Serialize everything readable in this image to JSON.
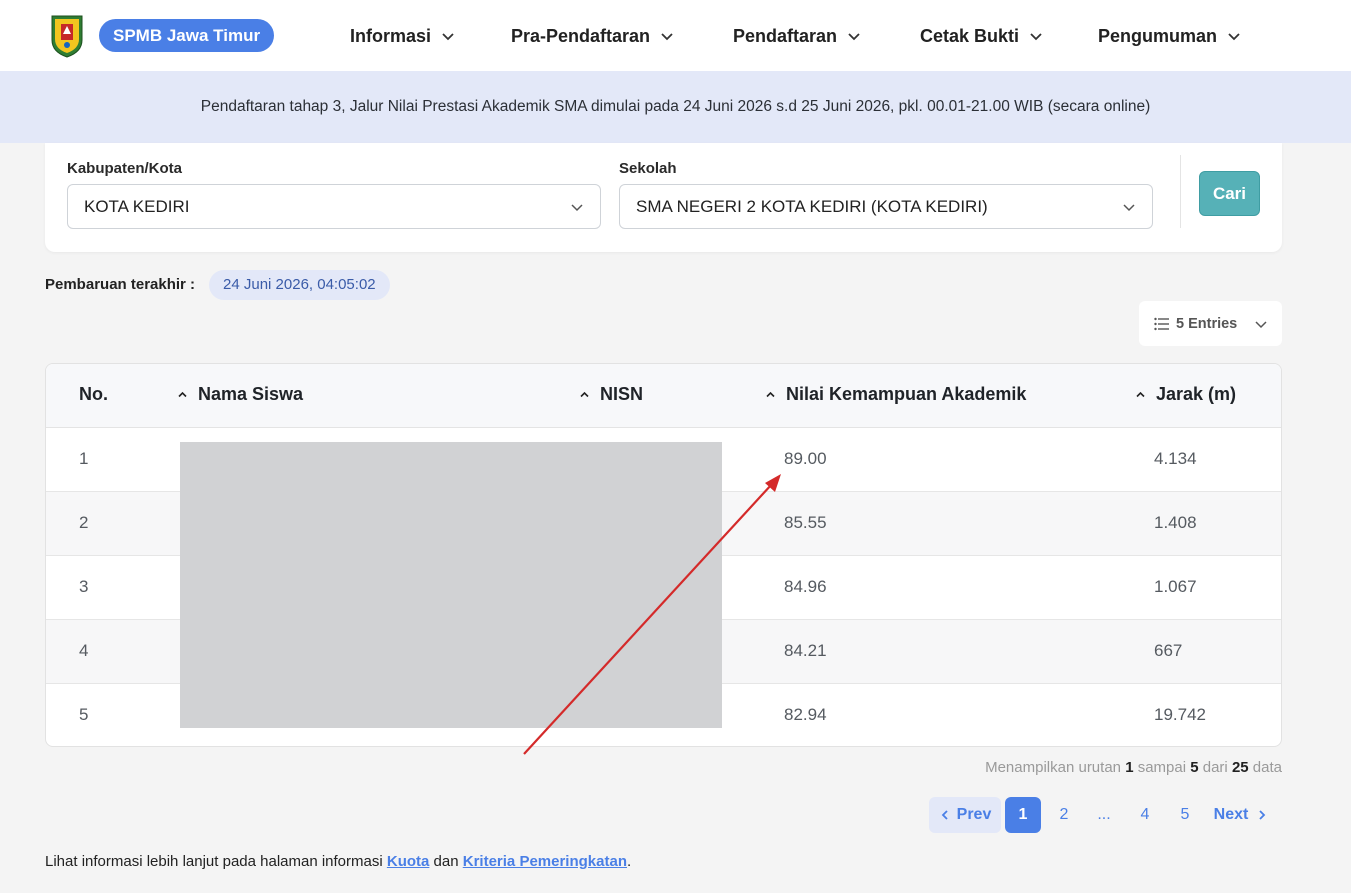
{
  "header": {
    "brand": "SPMB Jawa Timur",
    "nav": [
      {
        "label": "Informasi"
      },
      {
        "label": "Pra-Pendaftaran"
      },
      {
        "label": "Pendaftaran"
      },
      {
        "label": "Cetak Bukti"
      },
      {
        "label": "Pengumuman"
      }
    ]
  },
  "banner": {
    "text": "Pendaftaran tahap 3, Jalur Nilai Prestasi Akademik SMA dimulai pada 24 Juni 2026 s.d 25 Juni 2026, pkl. 00.01-21.00 WIB (secara online)"
  },
  "filter": {
    "kabupaten_label": "Kabupaten/Kota",
    "kabupaten_value": "KOTA KEDIRI",
    "sekolah_label": "Sekolah",
    "sekolah_value": "SMA NEGERI 2 KOTA KEDIRI (KOTA KEDIRI)",
    "search_button": "Cari"
  },
  "update": {
    "label": "Pembaruan terakhir :",
    "value": "24 Juni 2026, 04:05:02"
  },
  "entries": {
    "label": "5 Entries"
  },
  "table": {
    "columns": [
      "No.",
      "Nama Siswa",
      "NISN",
      "Nilai Kemampuan Akademik",
      "Jarak (m)"
    ],
    "rows": [
      {
        "no": "1",
        "nilai": "89.00",
        "jarak": "4.134"
      },
      {
        "no": "2",
        "nilai": "85.55",
        "jarak": "1.408"
      },
      {
        "no": "3",
        "nilai": "84.96",
        "jarak": "1.067"
      },
      {
        "no": "4",
        "nilai": "84.21",
        "jarak": "667"
      },
      {
        "no": "5",
        "nilai": "82.94",
        "jarak": "19.742"
      }
    ]
  },
  "showing": {
    "prefix": "Menampilkan urutan",
    "from": "1",
    "mid": "sampai",
    "to": "5",
    "of": "dari",
    "total": "25",
    "suffix": "data"
  },
  "pagination": {
    "prev": "Prev",
    "pages": [
      "1",
      "2",
      "...",
      "4",
      "5"
    ],
    "next": "Next"
  },
  "footer": {
    "prefix": "Lihat informasi lebih lanjut pada halaman informasi",
    "link1": "Kuota",
    "and": "dan",
    "link2": "Kriteria Pemeringkatan",
    "suffix": "."
  },
  "colors": {
    "accent": "#4a7fe6",
    "search_button": "#56b1b7",
    "banner_bg": "#e3e8f8",
    "annotation_arrow": "#d42a2a"
  },
  "icons": {
    "logo": "jawa-timur-emblem",
    "chevron": "chevron-down-icon",
    "sort": "sort-up-icon",
    "list": "list-icon"
  }
}
